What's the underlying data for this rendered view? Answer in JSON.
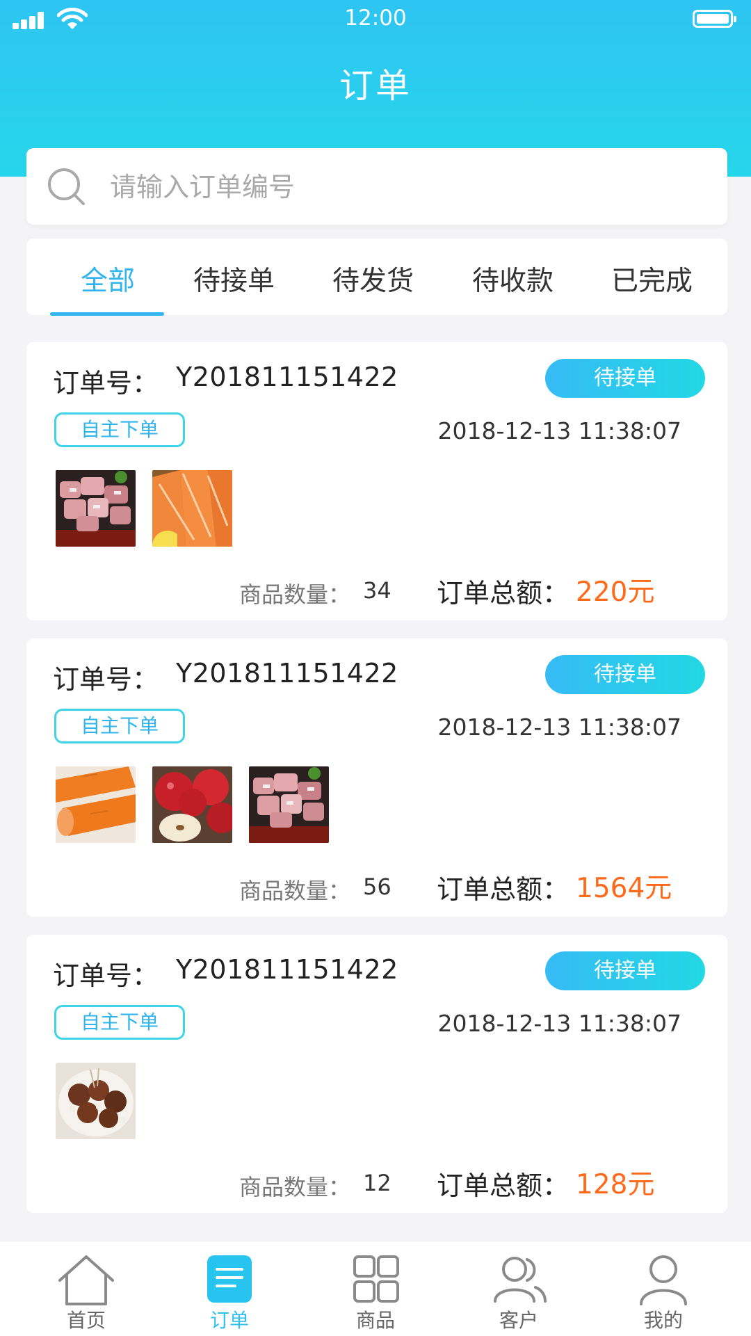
{
  "status_bar": {
    "time": "12:00"
  },
  "header": {
    "title": "订单"
  },
  "search": {
    "placeholder": "请输入订单编号"
  },
  "tabs": [
    {
      "label": "全部",
      "active": true
    },
    {
      "label": "待接单",
      "active": false
    },
    {
      "label": "待发货",
      "active": false
    },
    {
      "label": "待收款",
      "active": false
    },
    {
      "label": "已完成",
      "active": false
    }
  ],
  "orders": [
    {
      "order_label": "订单号：",
      "order_no": "Y201811151422",
      "status": "待接单",
      "source": "自主下单",
      "time": "2018-12-13 11:38:07",
      "items": [
        "pork-ribs-image",
        "salmon-image"
      ],
      "qty_label": "商品数量：",
      "qty": "34",
      "total_label": "订单总额：",
      "total": "220元"
    },
    {
      "order_label": "订单号：",
      "order_no": "Y201811151422",
      "status": "待接单",
      "source": "自主下单",
      "time": "2018-12-13 11:38:07",
      "items": [
        "carrot-image",
        "apple-image",
        "pork-ribs-image"
      ],
      "qty_label": "商品数量：",
      "qty": "56",
      "total_label": "订单总额：",
      "total": "1564元"
    },
    {
      "order_label": "订单号：",
      "order_no": "Y201811151422",
      "status": "待接单",
      "source": "自主下单",
      "time": "2018-12-13 11:38:07",
      "items": [
        "braised-dish-image"
      ],
      "qty_label": "商品数量：",
      "qty": "12",
      "total_label": "订单总额：",
      "total": "128元"
    }
  ],
  "tabbar": [
    {
      "label": "首页",
      "icon": "home-icon",
      "active": false
    },
    {
      "label": "订单",
      "icon": "orders-icon",
      "active": true
    },
    {
      "label": "商品",
      "icon": "products-grid-icon",
      "active": false
    },
    {
      "label": "客户",
      "icon": "customers-icon",
      "active": false
    },
    {
      "label": "我的",
      "icon": "profile-icon",
      "active": false
    }
  ],
  "colors": {
    "accent": "#2fb4ee",
    "header_top": "#2ec4f2",
    "header_bottom": "#27d6ea",
    "price": "#ff6a1a",
    "badge_start": "#36bbf5",
    "badge_end": "#22d8e3"
  }
}
